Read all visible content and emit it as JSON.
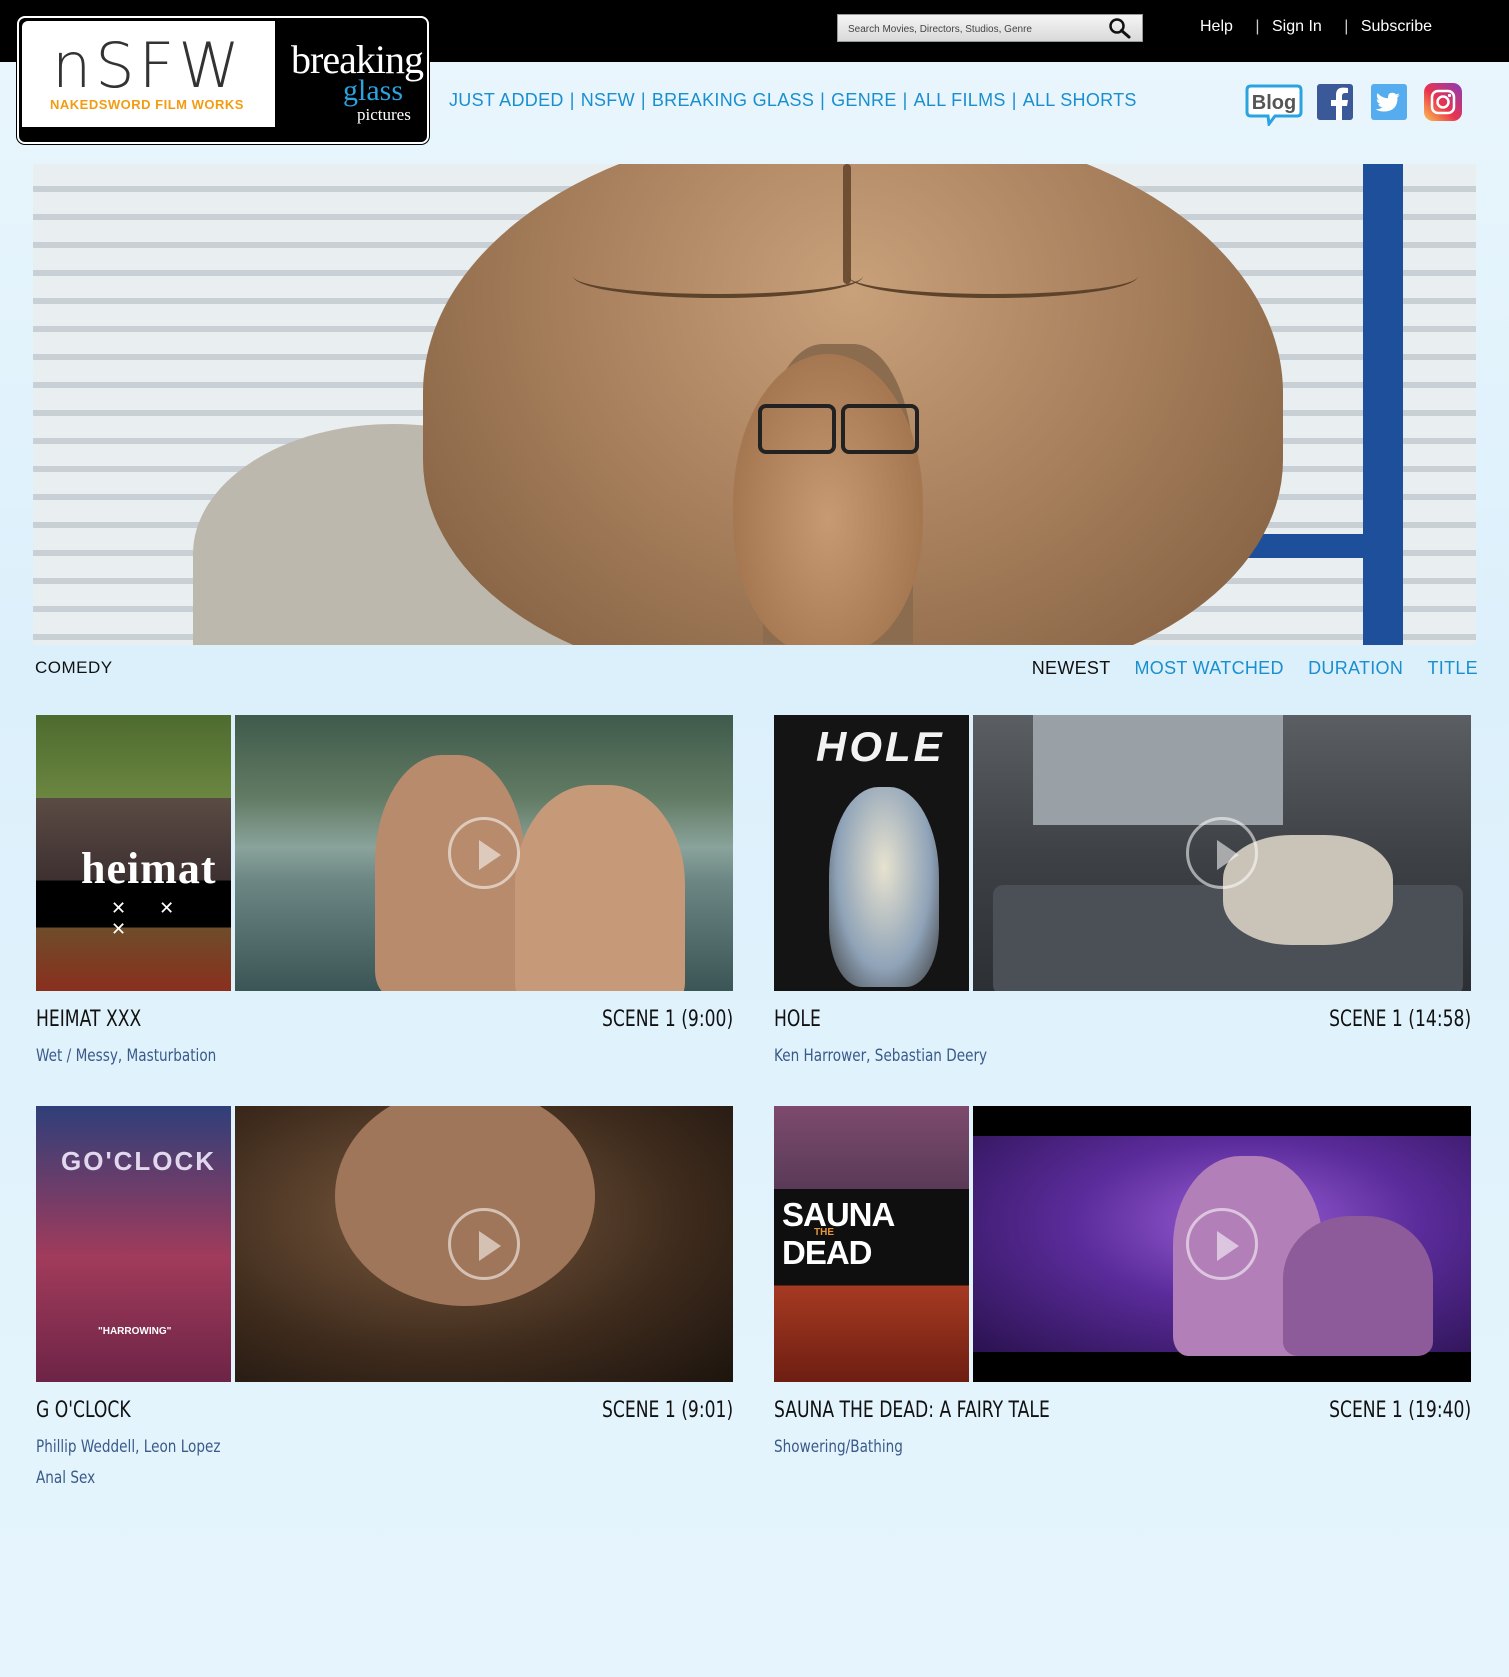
{
  "header": {
    "search_placeholder": "Search Movies, Directors, Studios, Genre",
    "links": [
      "Help",
      "Sign In",
      "Subscribe"
    ],
    "separator": "|"
  },
  "logo": {
    "nsfw": "nSFW",
    "nsfw_sub": "NAKEDSWORD FILM WORKS",
    "bg_line1": "breaking",
    "bg_line2": "glass",
    "bg_line3": "pictures"
  },
  "nav": {
    "items": [
      "JUST ADDED",
      "NSFW",
      "BREAKING GLASS",
      "GENRE",
      "ALL FILMS",
      "ALL SHORTS"
    ],
    "separator": "|"
  },
  "social": {
    "blog_label": "Blog",
    "icons": [
      "blog-icon",
      "facebook-icon",
      "twitter-icon",
      "instagram-icon"
    ],
    "colors": {
      "facebook": "#3b5998",
      "twitter": "#55acee",
      "blog": "#2aa3e0"
    }
  },
  "category": "COMEDY",
  "sort": {
    "options": [
      "NEWEST",
      "MOST WATCHED",
      "DURATION",
      "TITLE"
    ],
    "active": "NEWEST"
  },
  "films": [
    {
      "title": "HEIMAT XXX",
      "scene": "SCENE 1 (9:00)",
      "tags": [
        "Wet / Messy, Masturbation"
      ],
      "poster_title": "heimat",
      "poster_sub": "✕ ✕ ✕"
    },
    {
      "title": "HOLE",
      "scene": "SCENE 1 (14:58)",
      "tags": [
        "Ken Harrower, Sebastian Deery"
      ],
      "poster_title": "HOLE"
    },
    {
      "title": "G O'CLOCK",
      "scene": "SCENE 1 (9:01)",
      "tags": [
        "Phillip Weddell, Leon Lopez",
        "Anal Sex"
      ],
      "poster_title": "GO'CLOCK",
      "poster_sub": "\"HARROWING\""
    },
    {
      "title": "SAUNA THE DEAD: A FAIRY TALE",
      "scene": "SCENE 1 (19:40)",
      "tags": [
        "Showering/Bathing"
      ],
      "poster_title": "SAUNA",
      "poster_title2": "DEAD",
      "poster_the": "THE"
    }
  ],
  "colors": {
    "link_blue": "#1a8fcf",
    "tag_blue": "#3a5a8a",
    "accent_orange": "#f39c12"
  }
}
